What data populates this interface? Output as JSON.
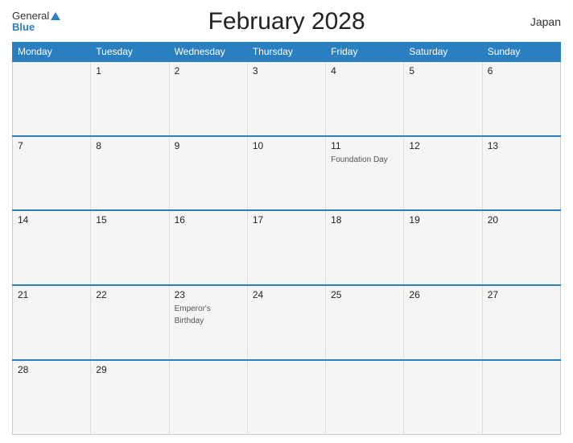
{
  "header": {
    "logo_general": "General",
    "logo_blue": "Blue",
    "title": "February 2028",
    "country": "Japan"
  },
  "weekdays": [
    "Monday",
    "Tuesday",
    "Wednesday",
    "Thursday",
    "Friday",
    "Saturday",
    "Sunday"
  ],
  "weeks": [
    [
      {
        "day": "",
        "event": ""
      },
      {
        "day": "1",
        "event": ""
      },
      {
        "day": "2",
        "event": ""
      },
      {
        "day": "3",
        "event": ""
      },
      {
        "day": "4",
        "event": ""
      },
      {
        "day": "5",
        "event": ""
      },
      {
        "day": "6",
        "event": ""
      }
    ],
    [
      {
        "day": "7",
        "event": ""
      },
      {
        "day": "8",
        "event": ""
      },
      {
        "day": "9",
        "event": ""
      },
      {
        "day": "10",
        "event": ""
      },
      {
        "day": "11",
        "event": "Foundation Day"
      },
      {
        "day": "12",
        "event": ""
      },
      {
        "day": "13",
        "event": ""
      }
    ],
    [
      {
        "day": "14",
        "event": ""
      },
      {
        "day": "15",
        "event": ""
      },
      {
        "day": "16",
        "event": ""
      },
      {
        "day": "17",
        "event": ""
      },
      {
        "day": "18",
        "event": ""
      },
      {
        "day": "19",
        "event": ""
      },
      {
        "day": "20",
        "event": ""
      }
    ],
    [
      {
        "day": "21",
        "event": ""
      },
      {
        "day": "22",
        "event": ""
      },
      {
        "day": "23",
        "event": "Emperor's Birthday"
      },
      {
        "day": "24",
        "event": ""
      },
      {
        "day": "25",
        "event": ""
      },
      {
        "day": "26",
        "event": ""
      },
      {
        "day": "27",
        "event": ""
      }
    ],
    [
      {
        "day": "28",
        "event": ""
      },
      {
        "day": "29",
        "event": ""
      },
      {
        "day": "",
        "event": ""
      },
      {
        "day": "",
        "event": ""
      },
      {
        "day": "",
        "event": ""
      },
      {
        "day": "",
        "event": ""
      },
      {
        "day": "",
        "event": ""
      }
    ]
  ]
}
